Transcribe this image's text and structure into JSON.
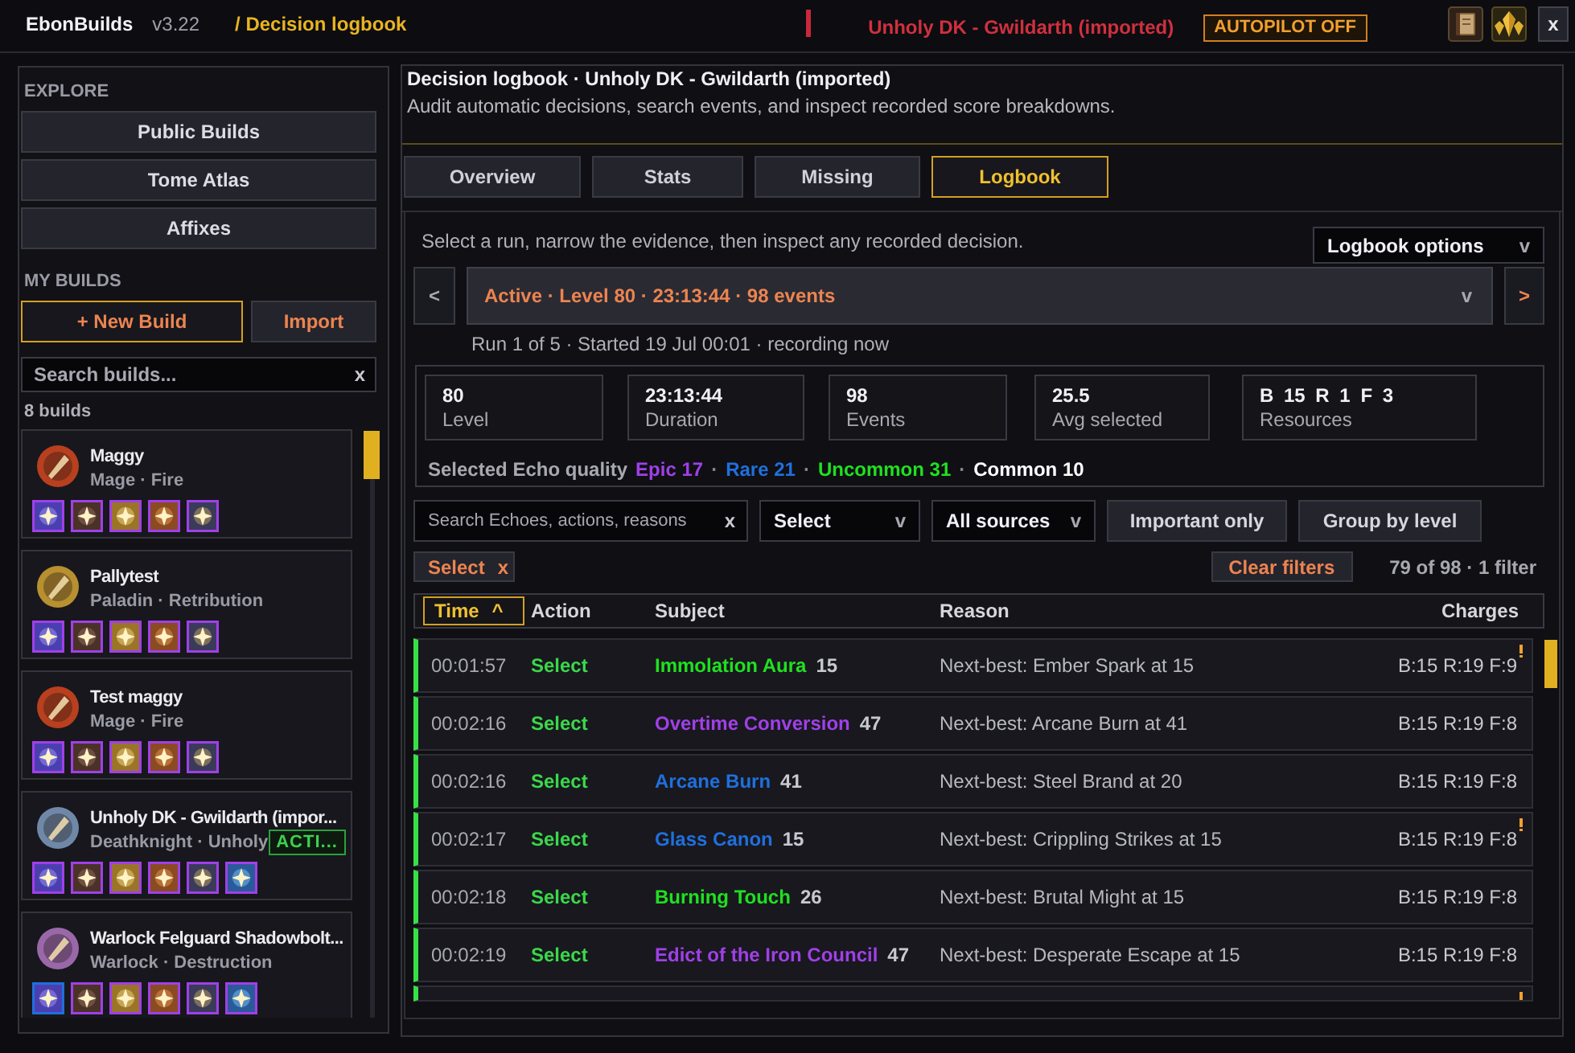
{
  "app": {
    "name": "EbonBuilds",
    "version": "v3.22",
    "breadcrumb": "/ Decision logbook",
    "build": "Unholy DK - Gwildarth (imported)",
    "autopilot": "AUTOPILOT OFF",
    "close": "x"
  },
  "sidebar": {
    "explore": {
      "label": "EXPLORE",
      "items": [
        "Public Builds",
        "Tome Atlas",
        "Affixes"
      ]
    },
    "my_builds": {
      "label": "MY BUILDS",
      "new_build": "+ New Build",
      "import": "Import",
      "search": {
        "placeholder": "Search builds...",
        "clear": "x"
      },
      "count": "8 builds",
      "builds": [
        {
          "name": "Maggy",
          "spec": "Mage · Fire",
          "color": "#b8401e",
          "echoes": [
            {
              "color": "#a040e8"
            },
            {
              "color": "#a040e8"
            },
            {
              "color": "#a040e8"
            },
            {
              "color": "#a040e8"
            },
            {
              "color": "#a040e8"
            }
          ]
        },
        {
          "name": "Pallytest",
          "spec": "Paladin · Retribution",
          "color": "#b89030",
          "echoes": [
            {
              "color": "#a040e8"
            },
            {
              "color": "#a040e8"
            },
            {
              "color": "#a040e8"
            },
            {
              "color": "#a040e8"
            },
            {
              "color": "#a040e8"
            }
          ]
        },
        {
          "name": "Test maggy",
          "spec": "Mage · Fire",
          "color": "#b8401e",
          "echoes": [
            {
              "color": "#a040e8"
            },
            {
              "color": "#a040e8"
            },
            {
              "color": "#a040e8"
            },
            {
              "color": "#a040e8"
            },
            {
              "color": "#a040e8"
            }
          ]
        },
        {
          "name": "Unholy DK - Gwildarth (impor...",
          "spec": "Deathknight · Unholy",
          "badge": "ACTI...",
          "color": "#7088a8",
          "echoes": [
            {
              "color": "#a040e8"
            },
            {
              "color": "#a040e8"
            },
            {
              "color": "#a040e8"
            },
            {
              "color": "#a040e8"
            },
            {
              "color": "#a040e8"
            },
            {
              "color": "#a040e8"
            }
          ]
        },
        {
          "name": "Warlock Felguard Shadowbolt...",
          "spec": "Warlock · Destruction",
          "color": "#9a68a8",
          "echoes": [
            {
              "color": "#1f70dd"
            },
            {
              "color": "#a040e8"
            },
            {
              "color": "#a040e8"
            },
            {
              "color": "#a040e8"
            },
            {
              "color": "#a040e8"
            },
            {
              "color": "#a040e8"
            }
          ]
        }
      ]
    }
  },
  "page": {
    "title": "Decision logbook · Unholy DK - Gwildarth (imported)",
    "description": "Audit automatic decisions, search events, and inspect recorded score breakdowns."
  },
  "tabs": [
    {
      "label": "Overview",
      "selected": false
    },
    {
      "label": "Stats",
      "selected": false
    },
    {
      "label": "Missing",
      "selected": false
    },
    {
      "label": "Logbook",
      "selected": true
    }
  ],
  "logbook": {
    "hint": "Select a run, narrow the evidence, then inspect any recorded decision.",
    "options": {
      "label": "Logbook options",
      "caret": "v"
    },
    "run": {
      "previous": "<",
      "label": "Active · Level 80 · 23:13:44 · 98 events",
      "caret": "v",
      "next": ">",
      "info": "Run 1 of 5 · Started 19 Jul 00:01 · recording now"
    },
    "stats": [
      {
        "value": "80",
        "label": "Level"
      },
      {
        "value": "23:13:44",
        "label": "Duration"
      },
      {
        "value": "98",
        "label": "Events"
      },
      {
        "value": "25.5",
        "label": "Avg selected"
      },
      {
        "value": "B 15 R 1 F 3",
        "label": "Resources"
      }
    ],
    "quality": {
      "label": "Selected Echo quality",
      "items": [
        {
          "text": "Epic 17",
          "color": "#a040e8"
        },
        {
          "text": "Rare 21",
          "color": "#1f70dd"
        },
        {
          "text": "Uncommon 31",
          "color": "#20e020"
        },
        {
          "text": "Common 10",
          "color": "#ffffff"
        }
      ],
      "separators": [
        "·",
        "·",
        "·"
      ]
    },
    "filters": {
      "search": {
        "placeholder": "Search Echoes, actions, reasons",
        "clear": "x"
      },
      "dropdowns": [
        {
          "value": "Select",
          "caret": "v"
        },
        {
          "value": "All sources",
          "caret": "v"
        }
      ],
      "buttons": [
        "Important only",
        "Group by level"
      ],
      "chips": [
        {
          "label": "Select",
          "remove": "x"
        }
      ],
      "clear": "Clear filters",
      "count": "79 of 98 · 1 filter"
    }
  },
  "table": {
    "columns": [
      {
        "label": "Time",
        "sort": "^",
        "selected": true
      },
      {
        "label": "Action",
        "selected": false
      },
      {
        "label": "Subject",
        "selected": false
      },
      {
        "label": "Reason",
        "selected": false
      },
      {
        "label": "Charges",
        "selected": false
      }
    ],
    "rows": [
      {
        "time": "00:01:57",
        "action": "Select",
        "subject": {
          "name": "Immolation Aura",
          "color": "#20e020",
          "score": "15"
        },
        "reason": "Next-best: Ember Spark at 15",
        "charges": "B:15 R:19 F:9",
        "flagged": true
      },
      {
        "time": "00:02:16",
        "action": "Select",
        "subject": {
          "name": "Overtime Conversion",
          "color": "#a040e8",
          "score": "47"
        },
        "reason": "Next-best: Arcane Burn at 41",
        "charges": "B:15 R:19 F:8",
        "flagged": false
      },
      {
        "time": "00:02:16",
        "action": "Select",
        "subject": {
          "name": "Arcane Burn",
          "color": "#1f70dd",
          "score": "41"
        },
        "reason": "Next-best: Steel Brand at 20",
        "charges": "B:15 R:19 F:8",
        "flagged": false
      },
      {
        "time": "00:02:17",
        "action": "Select",
        "subject": {
          "name": "Glass Canon",
          "color": "#1f70dd",
          "score": "15"
        },
        "reason": "Next-best: Crippling Strikes at 15",
        "charges": "B:15 R:19 F:8",
        "flagged": true
      },
      {
        "time": "00:02:18",
        "action": "Select",
        "subject": {
          "name": "Burning Touch",
          "color": "#20e020",
          "score": "26"
        },
        "reason": "Next-best: Brutal Might at 15",
        "charges": "B:15 R:19 F:8",
        "flagged": false
      },
      {
        "time": "00:02:19",
        "action": "Select",
        "subject": {
          "name": "Edict of the Iron Council",
          "color": "#a040e8",
          "score": "47"
        },
        "reason": "Next-best: Desperate Escape at 15",
        "charges": "B:15 R:19 F:8",
        "flagged": false
      },
      {
        "flagged": true
      }
    ]
  }
}
